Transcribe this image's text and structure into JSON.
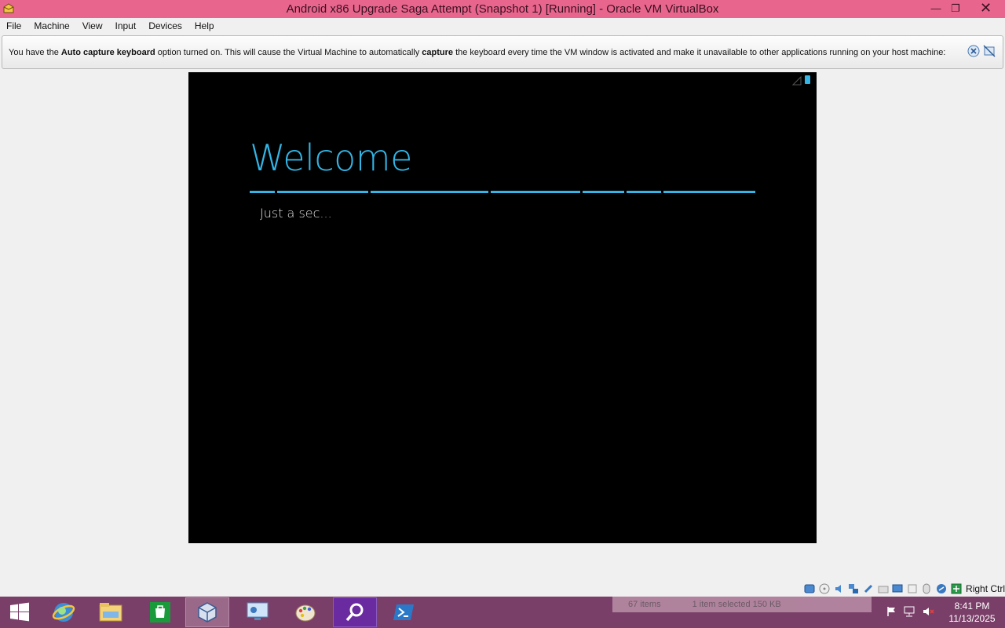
{
  "window": {
    "title": "Android x86 Upgrade Saga Attempt (Snapshot 1) [Running] - Oracle VM VirtualBox",
    "minimize": "—",
    "maximize": "❐",
    "close": "✕"
  },
  "menu": [
    "File",
    "Machine",
    "View",
    "Input",
    "Devices",
    "Help"
  ],
  "notice": {
    "part1": "You have the ",
    "bold1": "Auto capture keyboard",
    "part2": " option turned on. This will cause the Virtual Machine to automatically ",
    "bold2": "capture",
    "part3": " the keyboard every time the VM window is activated and make it unavailable to other applications running on your host machine:"
  },
  "android": {
    "title": "Welcome",
    "subtitle": "Just a sec...",
    "accent": "#33b5e5"
  },
  "vbox_status": {
    "icons": [
      "hard-disk-icon",
      "optical-drive-icon",
      "audio-icon",
      "network-icon",
      "usb-icon",
      "shared-folders-icon",
      "display-icon",
      "video-capture-icon",
      "mouse-integration-icon",
      "keyboard-capture-icon",
      "cpu-icon"
    ],
    "host_key": "Right Ctrl"
  },
  "taskbar": {
    "apps": [
      "internet-explorer-icon",
      "file-explorer-icon",
      "store-icon",
      "virtualbox-icon",
      "remote-desktop-icon",
      "paint-icon",
      "search-app-icon",
      "powershell-icon"
    ],
    "ghost_items": "67 items",
    "ghost_selected": "1 item selected  150 KB",
    "time": "8:41 PM",
    "date": "11/13/2025"
  }
}
